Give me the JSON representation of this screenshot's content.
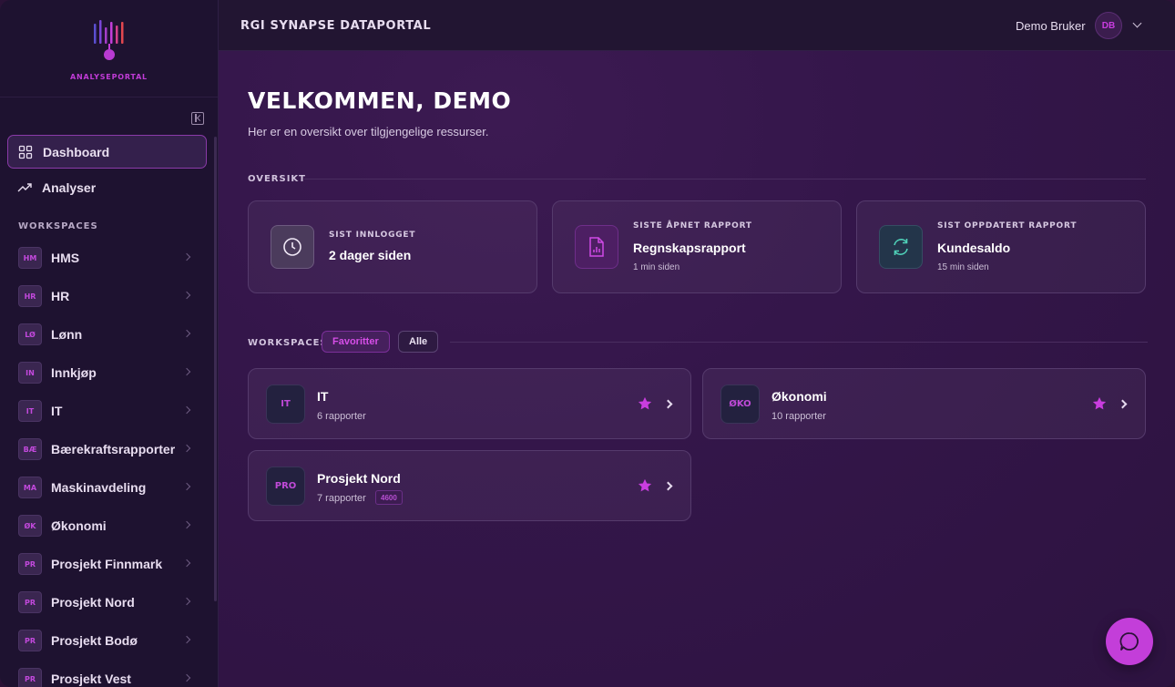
{
  "brand": {
    "logo_text": "ANALYSEPORTAL",
    "accent": "#c33ed9"
  },
  "header": {
    "app_title": "RGI SYNAPSE DATAPORTAL",
    "user_name": "Demo Bruker",
    "avatar_initials": "DB"
  },
  "sidebar": {
    "nav": [
      {
        "label": "Dashboard",
        "icon": "dashboard-grid-icon",
        "active": true
      },
      {
        "label": "Analyser",
        "icon": "trending-up-icon",
        "active": false
      }
    ],
    "workspaces_label": "WORKSPACES",
    "workspaces": [
      {
        "badge": "HM",
        "label": "HMS"
      },
      {
        "badge": "HR",
        "label": "HR"
      },
      {
        "badge": "LØ",
        "label": "Lønn"
      },
      {
        "badge": "IN",
        "label": "Innkjøp"
      },
      {
        "badge": "IT",
        "label": "IT"
      },
      {
        "badge": "BÆ",
        "label": "Bærekraftsrapporter"
      },
      {
        "badge": "MA",
        "label": "Maskinavdeling"
      },
      {
        "badge": "ØK",
        "label": "Økonomi"
      },
      {
        "badge": "PR",
        "label": "Prosjekt Finnmark"
      },
      {
        "badge": "PR",
        "label": "Prosjekt Nord"
      },
      {
        "badge": "PR",
        "label": "Prosjekt Bodø"
      },
      {
        "badge": "PR",
        "label": "Prosjekt Vest"
      }
    ]
  },
  "main": {
    "title": "VELKOMMEN, DEMO",
    "subtitle": "Her er en oversikt over tilgjengelige ressurser.",
    "overview_label": "OVERSIKT",
    "stats": [
      {
        "label": "SIST INNLOGGET",
        "value": "2 dager siden",
        "sub": "",
        "icon": "clock-icon"
      },
      {
        "label": "SISTE ÅPNET RAPPORT",
        "value": "Regnskapsrapport",
        "sub": "1 min siden",
        "icon": "report-file-icon"
      },
      {
        "label": "SIST OPPDATERT RAPPORT",
        "value": "Kundesaldo",
        "sub": "15 min siden",
        "icon": "refresh-icon"
      }
    ],
    "workspaces_label": "WORKSPACES",
    "filters": {
      "favorites": "Favoritter",
      "all": "Alle"
    },
    "favorite_workspaces": [
      {
        "badge": "IT",
        "name": "IT",
        "count": "6 rapporter",
        "tag": ""
      },
      {
        "badge": "ØKO",
        "name": "Økonomi",
        "count": "10 rapporter",
        "tag": ""
      },
      {
        "badge": "PRO",
        "name": "Prosjekt Nord",
        "count": "7 rapporter",
        "tag": "4600"
      }
    ]
  }
}
